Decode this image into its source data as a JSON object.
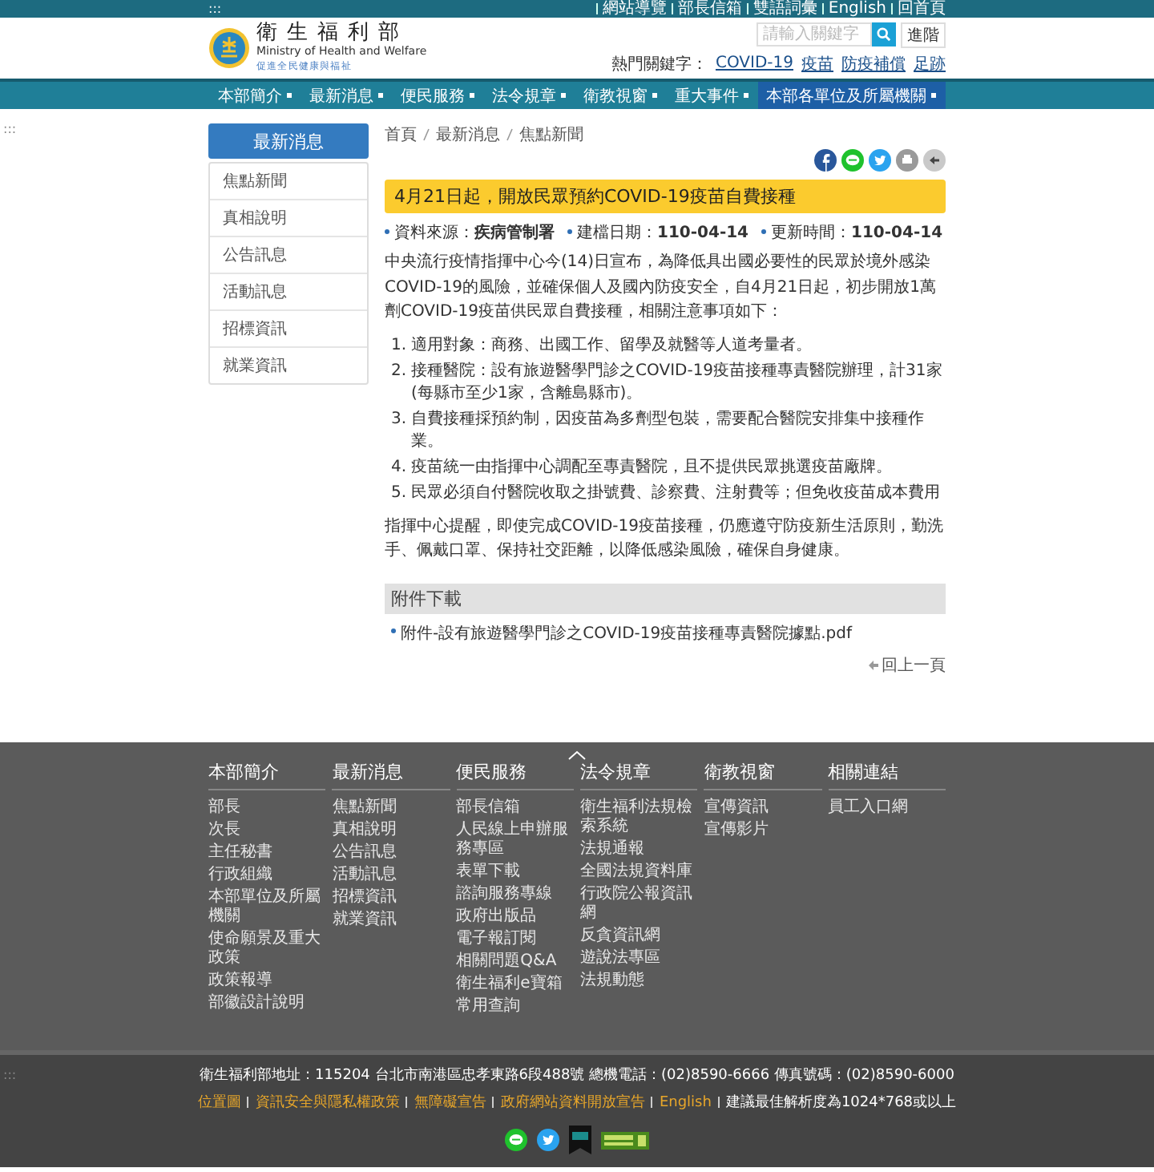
{
  "top_bar": {
    "accesskey": ":::",
    "links": [
      "網站導覽",
      "部長信箱",
      "雙語詞彙",
      "English",
      "回首頁"
    ]
  },
  "header": {
    "title": "衛生福利部",
    "subtitle": "Ministry of Health and Welfare",
    "tagline": "促進全民健康與福祉",
    "search": {
      "placeholder": "請輸入關鍵字"
    },
    "advanced_button": "進階",
    "hot_keywords": {
      "label": "熱門關鍵字：",
      "items": [
        "COVID-19",
        "疫苗",
        "防疫補償",
        "足跡"
      ]
    }
  },
  "nav": [
    {
      "label": "本部簡介",
      "selected": false
    },
    {
      "label": "最新消息",
      "selected": false
    },
    {
      "label": "便民服務",
      "selected": false
    },
    {
      "label": "法令規章",
      "selected": false
    },
    {
      "label": "衛教視窗",
      "selected": false
    },
    {
      "label": "重大事件",
      "selected": false
    },
    {
      "label": "本部各單位及所屬機關",
      "selected": true
    }
  ],
  "main_accesskey": ":::",
  "sidebar": {
    "title": "最新消息",
    "items": [
      "焦點新聞",
      "真相說明",
      "公告訊息",
      "活動訊息",
      "招標資訊",
      "就業資訊"
    ]
  },
  "breadcrumb": [
    "首頁",
    "最新消息",
    "焦點新聞"
  ],
  "article": {
    "title": "4月21日起，開放民眾預約COVID-19疫苗自費接種",
    "meta": [
      {
        "label": "資料來源：",
        "value": "疾病管制署"
      },
      {
        "label": "建檔日期：",
        "value": "110-04-14"
      },
      {
        "label": "更新時間：",
        "value": "110-04-14"
      }
    ],
    "intro": "中央流行疫情指揮中心今(14)日宣布，為降低具出國必要性的民眾於境外感染COVID-19的風險，並確保個人及國內防疫安全，自4月21日起，初步開放1萬劑COVID-19疫苗供民眾自費接種，相關注意事項如下：",
    "items": [
      {
        "number": "1.",
        "text": "適用對象：商務、出國工作、留學及就醫等人道考量者。"
      },
      {
        "number": "2.",
        "text": "接種醫院：設有旅遊醫學門診之COVID-19疫苗接種專責醫院辦理，計31家(每縣市至少1家，含離島縣市)。"
      },
      {
        "number": "3.",
        "text": "自費接種採預約制，因疫苗為多劑型包裝，需要配合醫院安排集中接種作業。"
      },
      {
        "number": "4.",
        "text": "疫苗統一由指揮中心調配至專責醫院，且不提供民眾挑選疫苗廠牌。"
      },
      {
        "number": "5.",
        "text": "民眾必須自付醫院收取之掛號費、診察費、注射費等；但免收疫苗成本費用"
      }
    ],
    "closing": "指揮中心提醒，即使完成COVID-19疫苗接種，仍應遵守防疫新生活原則，勤洗手、佩戴口罩、保持社交距離，以降低感染風險，確保自身健康。",
    "attachments": {
      "title": "附件下載",
      "files": [
        "附件-設有旅遊醫學門診之COVID-19疫苗接種專責醫院據點.pdf"
      ]
    },
    "back_link": "回上一頁"
  },
  "footer": {
    "columns": [
      {
        "title": "本部簡介",
        "links": [
          "部長",
          "次長",
          "主任秘書",
          "行政組織",
          "本部單位及所屬機關",
          "使命願景及重大政策",
          "政策報導",
          "部徽設計說明"
        ]
      },
      {
        "title": "最新消息",
        "links": [
          "焦點新聞",
          "真相說明",
          "公告訊息",
          "活動訊息",
          "招標資訊",
          "就業資訊"
        ]
      },
      {
        "title": "便民服務",
        "links": [
          "部長信箱",
          "人民線上申辦服務專區",
          "表單下載",
          "諮詢服務專線",
          "政府出版品",
          "電子報訂閱",
          "相關問題Q&A",
          "衛生福利e寶箱",
          "常用查詢"
        ]
      },
      {
        "title": "法令規章",
        "links": [
          "衛生福利法規檢索系統",
          "法規通報",
          "全國法規資料庫",
          "行政院公報資訊網",
          "反貪資訊網",
          "遊說法專區",
          "法規動態"
        ]
      },
      {
        "title": "衛教視窗",
        "links": [
          "宣傳資訊",
          "宣傳影片"
        ]
      },
      {
        "title": "相關連結",
        "links": [
          "員工入口網"
        ]
      }
    ]
  },
  "bottom": {
    "accesskey": ":::",
    "address": "衛生福利部地址：115204 台北市南港區忠孝東路6段488號 總機電話：(02)8590-6666 傳真號碼：(02)8590-6000",
    "links": [
      "位置圖",
      "資訊安全與隱私權政策",
      "無障礙宣告",
      "政府網站資料開放宣告",
      "English"
    ],
    "resolution_note": "建議最佳解析度為1024*768或以上"
  }
}
